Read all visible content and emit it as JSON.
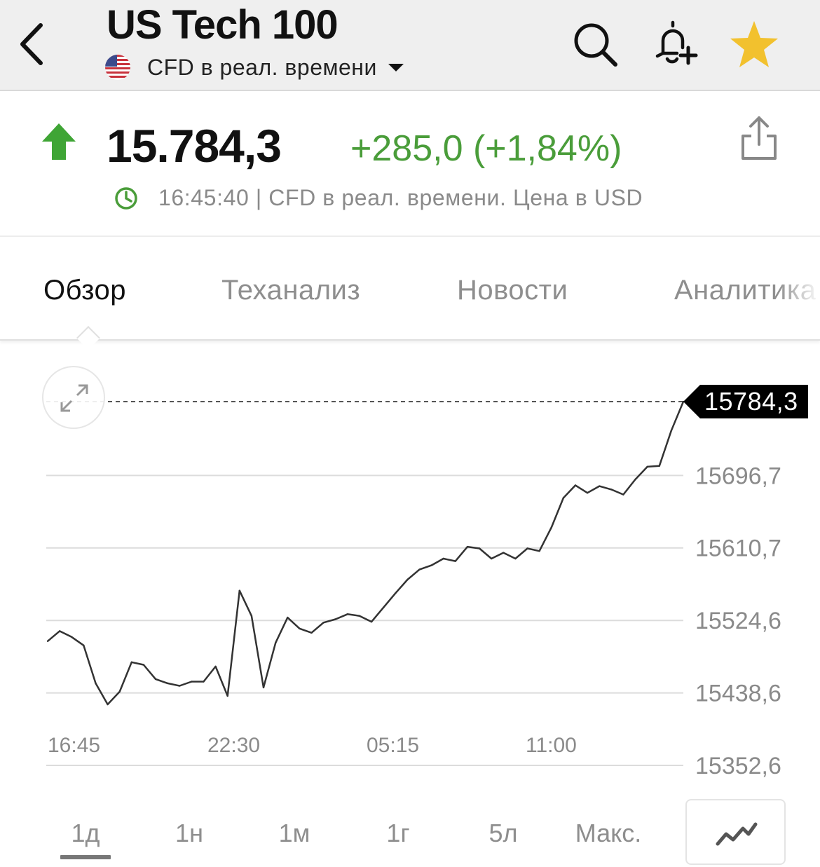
{
  "header": {
    "title": "US Tech 100",
    "subtitle": "CFD в реал. времени",
    "icons": [
      "back-icon",
      "search-icon",
      "bell-plus-icon",
      "star-icon"
    ],
    "star_color": "#f2c12e"
  },
  "quote": {
    "price": "15.784,3",
    "change": "+285,0 (+1,84%)",
    "timestamp_line": "16:45:40 | CFD в реал. времени. Цена в USD",
    "up_color": "#3fa535",
    "change_color": "#4a9d3a"
  },
  "tabs": [
    {
      "label": "Обзор",
      "active": true
    },
    {
      "label": "Теханализ",
      "active": false
    },
    {
      "label": "Новости",
      "active": false
    },
    {
      "label": "Аналитика",
      "active": false
    }
  ],
  "chart_data": {
    "type": "line",
    "x_tick_labels": [
      "16:45",
      "22:30",
      "05:15",
      "11:00"
    ],
    "y_tick_labels": [
      "15696,7",
      "15610,7",
      "15524,6",
      "15438,6",
      "15352,6"
    ],
    "ylim": [
      15352.6,
      15784.3
    ],
    "current_price_label": "15784,3",
    "grid": true,
    "series": [
      {
        "values": [
          15500,
          15512,
          15505,
          15495,
          15450,
          15425,
          15440,
          15475,
          15472,
          15455,
          15450,
          15447,
          15452,
          15452,
          15470,
          15435,
          15560,
          15530,
          15445,
          15498,
          15528,
          15515,
          15510,
          15522,
          15526,
          15532,
          15530,
          15523,
          15540,
          15557,
          15573,
          15585,
          15590,
          15598,
          15595,
          15612,
          15610,
          15598,
          15605,
          15598,
          15610,
          15607,
          15635,
          15670,
          15685,
          15676,
          15684,
          15680,
          15674,
          15692,
          15707,
          15708,
          15750,
          15784.3
        ]
      }
    ]
  },
  "periods": [
    {
      "label": "1д",
      "active": true
    },
    {
      "label": "1н",
      "active": false
    },
    {
      "label": "1м",
      "active": false
    },
    {
      "label": "1г",
      "active": false
    },
    {
      "label": "5л",
      "active": false
    },
    {
      "label": "Макс.",
      "active": false
    }
  ]
}
